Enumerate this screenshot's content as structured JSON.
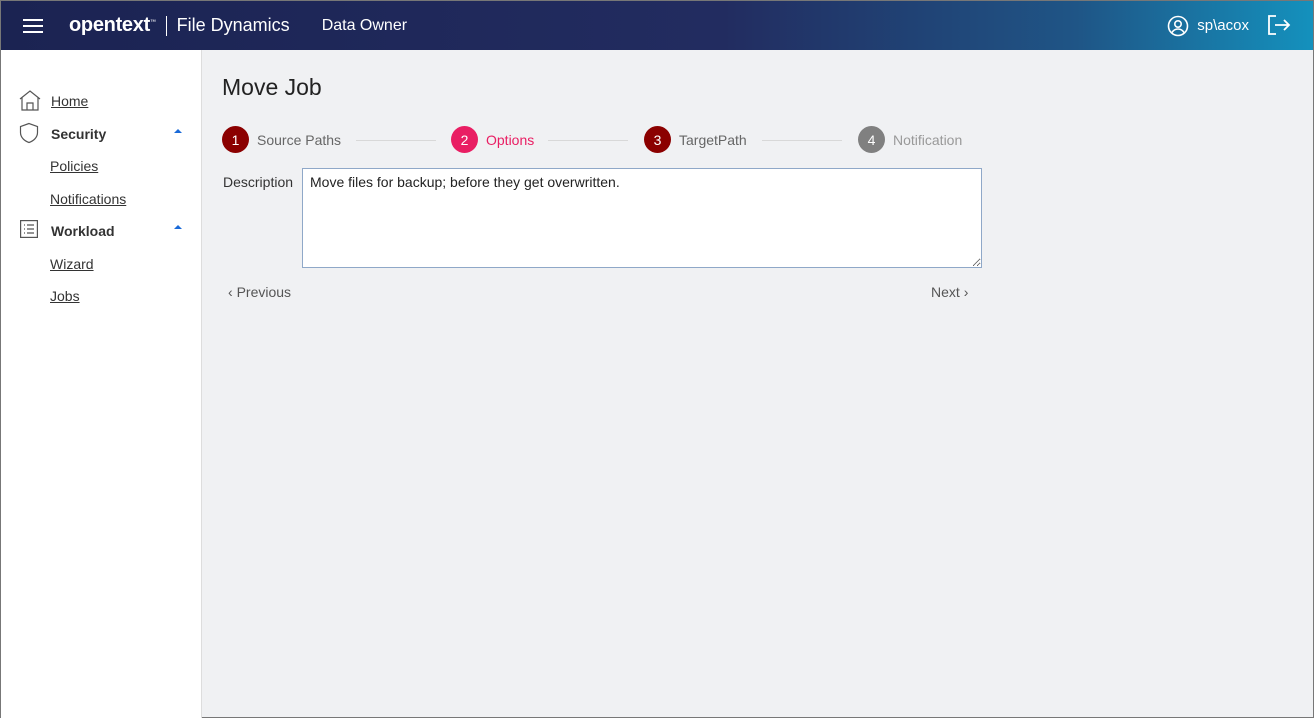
{
  "header": {
    "logo": "opentext",
    "product": "File Dynamics",
    "role": "Data Owner",
    "user": "sp\\acox"
  },
  "sidebar": {
    "home": "Home",
    "security": "Security",
    "policies": "Policies",
    "notifications": "Notifications",
    "workload": "Workload",
    "wizard": "Wizard",
    "jobs": "Jobs"
  },
  "page": {
    "title": "Move Job"
  },
  "steps": [
    {
      "num": "1",
      "label": "Source Paths",
      "color": "#8b0000",
      "state": "complete"
    },
    {
      "num": "2",
      "label": "Options",
      "color": "#e91e63",
      "state": "active"
    },
    {
      "num": "3",
      "label": "TargetPath",
      "color": "#8b0000",
      "state": "complete"
    },
    {
      "num": "4",
      "label": "Notification",
      "color": "#808080",
      "state": "pending"
    }
  ],
  "form": {
    "description_label": "Description",
    "description_value": "Move files for backup; before they get overwritten."
  },
  "nav": {
    "previous": "Previous",
    "next": "Next"
  }
}
